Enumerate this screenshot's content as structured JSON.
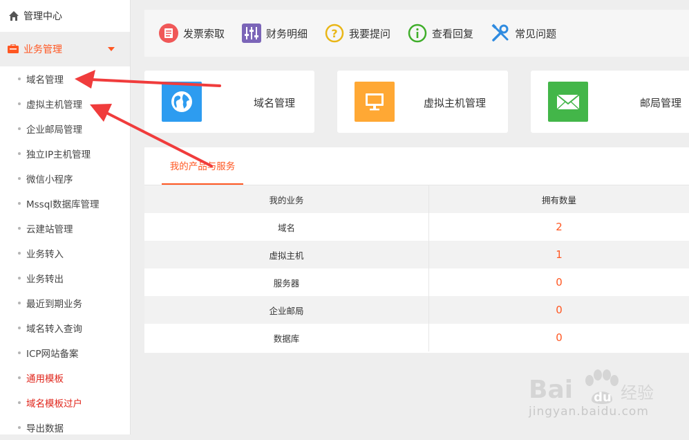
{
  "sidebar": {
    "top_label": "管理中心",
    "group_label": "业务管理",
    "items": [
      {
        "label": "域名管理",
        "highlight": false
      },
      {
        "label": "虚拟主机管理",
        "highlight": false
      },
      {
        "label": "企业邮局管理",
        "highlight": false
      },
      {
        "label": "独立IP主机管理",
        "highlight": false
      },
      {
        "label": "微信小程序",
        "highlight": false
      },
      {
        "label": "Mssql数据库管理",
        "highlight": false
      },
      {
        "label": "云建站管理",
        "highlight": false
      },
      {
        "label": "业务转入",
        "highlight": false
      },
      {
        "label": "业务转出",
        "highlight": false
      },
      {
        "label": "最近到期业务",
        "highlight": false
      },
      {
        "label": "域名转入查询",
        "highlight": false
      },
      {
        "label": "ICP网站备案",
        "highlight": false
      },
      {
        "label": "通用模板",
        "highlight": true
      },
      {
        "label": "域名模板过户",
        "highlight": true
      },
      {
        "label": "导出数据",
        "highlight": false
      }
    ]
  },
  "toolbar": {
    "items": [
      {
        "label": "发票索取",
        "icon": "invoice-icon"
      },
      {
        "label": "财务明细",
        "icon": "finance-sliders-icon"
      },
      {
        "label": "我要提问",
        "icon": "question-icon"
      },
      {
        "label": "查看回复",
        "icon": "info-icon"
      },
      {
        "label": "常见问题",
        "icon": "tools-icon"
      }
    ]
  },
  "cards": [
    {
      "label": "域名管理",
      "icon": "globe-icon",
      "color": "#2d9cf0"
    },
    {
      "label": "虚拟主机管理",
      "icon": "monitor-icon",
      "color": "#ffa834"
    },
    {
      "label": "邮局管理",
      "icon": "mail-icon",
      "color": "#43b649"
    }
  ],
  "panel": {
    "tab_label": "我的产品与服务",
    "headers": [
      "我的业务",
      "拥有数量"
    ],
    "rows": [
      {
        "name": "域名",
        "count": "2"
      },
      {
        "name": "虚拟主机",
        "count": "1"
      },
      {
        "name": "服务器",
        "count": "0"
      },
      {
        "name": "企业邮局",
        "count": "0"
      },
      {
        "name": "数据库",
        "count": "0"
      }
    ]
  },
  "watermark": {
    "brand": "Baidu经验",
    "url": "jingyan.baidu.com"
  },
  "colors": {
    "accent": "#ff5722",
    "red_link": "#e0251b",
    "annotation_arrow": "#f03c3c"
  }
}
